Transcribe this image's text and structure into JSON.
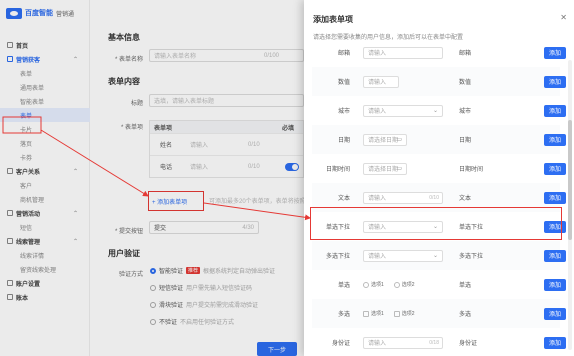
{
  "sidebar": {
    "brand": "百度智能",
    "brand_sub": "营销通",
    "items": [
      {
        "label": "首页",
        "type": "group",
        "has_chevron": false
      },
      {
        "label": "营销获客",
        "type": "group",
        "has_chevron": true,
        "active": true
      },
      {
        "label": "表单",
        "type": "sub"
      },
      {
        "label": "通用表单",
        "type": "sub"
      },
      {
        "label": "智能表单",
        "type": "sub"
      },
      {
        "label": "表单",
        "type": "sub",
        "selected": true
      },
      {
        "label": "卡片",
        "type": "sub"
      },
      {
        "label": "落页",
        "type": "sub"
      },
      {
        "label": "卡券",
        "type": "sub"
      },
      {
        "label": "客户关系",
        "type": "group",
        "has_chevron": true
      },
      {
        "label": "客户",
        "type": "sub"
      },
      {
        "label": "商机管理",
        "type": "sub"
      },
      {
        "label": "营销活动",
        "type": "group",
        "has_chevron": true
      },
      {
        "label": "短信",
        "type": "sub"
      },
      {
        "label": "线索管理",
        "type": "group",
        "has_chevron": true
      },
      {
        "label": "线索详情",
        "type": "sub"
      },
      {
        "label": "留资线索处理",
        "type": "sub"
      },
      {
        "label": "账户设置",
        "type": "group",
        "has_chevron": false
      },
      {
        "label": "账本",
        "type": "group",
        "has_chevron": false
      }
    ]
  },
  "main": {
    "basic_title": "基本信息",
    "form_name_label": "* 表单名称",
    "form_name_placeholder": "请输入表单名称",
    "form_name_count": "0/100",
    "content_title": "表单内容",
    "heading_label": "标题",
    "heading_placeholder": "选填，请输入表单标题",
    "content_label": "* 表单项",
    "table_headers": [
      "表单项",
      "必填"
    ],
    "table_rows": [
      {
        "name": "姓名",
        "placeholder": "请输入",
        "count": "0/10"
      },
      {
        "name": "电话",
        "placeholder": "请输入",
        "count": "0/10"
      }
    ],
    "add_link": "+ 添加表单项",
    "add_hint": "可添加最多20个表单项，表单将按照下面的顺序排列",
    "submit_label": "* 提交按钮",
    "submit_value": "提交",
    "submit_count": "4/30",
    "verify_title": "用户验证",
    "verify_label": "验证方式",
    "verify_options": [
      {
        "label": "智能验证",
        "tag": "推荐",
        "desc": "根据系统判定自动弹出验证",
        "selected": true
      },
      {
        "label": "短信验证",
        "desc": "用户需先输入短信验证码"
      },
      {
        "label": "滑块验证",
        "desc": "用户提交前需完成滑动验证"
      },
      {
        "label": "不验证",
        "desc": "不启用任何验证方式"
      }
    ],
    "next_button": "下一步"
  },
  "drawer": {
    "title": "添加表单项",
    "subtitle": "请选择您需要收集的用户信息，添加后可以在表单中配置",
    "add_button": "添加",
    "fields": [
      {
        "label": "邮箱",
        "placeholder": "请输入",
        "type": "邮箱",
        "kind": "input"
      },
      {
        "label": "数值",
        "placeholder": "请输入",
        "type": "数值",
        "kind": "input-short"
      },
      {
        "label": "城市",
        "placeholder": "请输入",
        "type": "城市",
        "kind": "select"
      },
      {
        "label": "日期",
        "placeholder": "请选择日期",
        "type": "日期",
        "kind": "date"
      },
      {
        "label": "日期时间",
        "placeholder": "请选择日期",
        "type": "日期时间",
        "kind": "date"
      },
      {
        "label": "文本",
        "placeholder": "请输入",
        "type": "文本",
        "kind": "input",
        "count": "0/10"
      },
      {
        "label": "单选下拉",
        "placeholder": "请输入",
        "type": "单选下拉",
        "kind": "select"
      },
      {
        "label": "多选下拉",
        "placeholder": "请输入",
        "type": "多选下拉",
        "kind": "select"
      },
      {
        "label": "单选",
        "type": "单选",
        "kind": "radio",
        "options": [
          "选项1",
          "选项2"
        ]
      },
      {
        "label": "多选",
        "type": "多选",
        "kind": "checkbox",
        "options": [
          "选项1",
          "选项2"
        ]
      },
      {
        "label": "身份证",
        "placeholder": "请输入",
        "type": "身份证",
        "kind": "input",
        "count": "0/18"
      }
    ]
  },
  "colors": {
    "accent": "#2d6ef2",
    "annotation": "#e53935"
  }
}
